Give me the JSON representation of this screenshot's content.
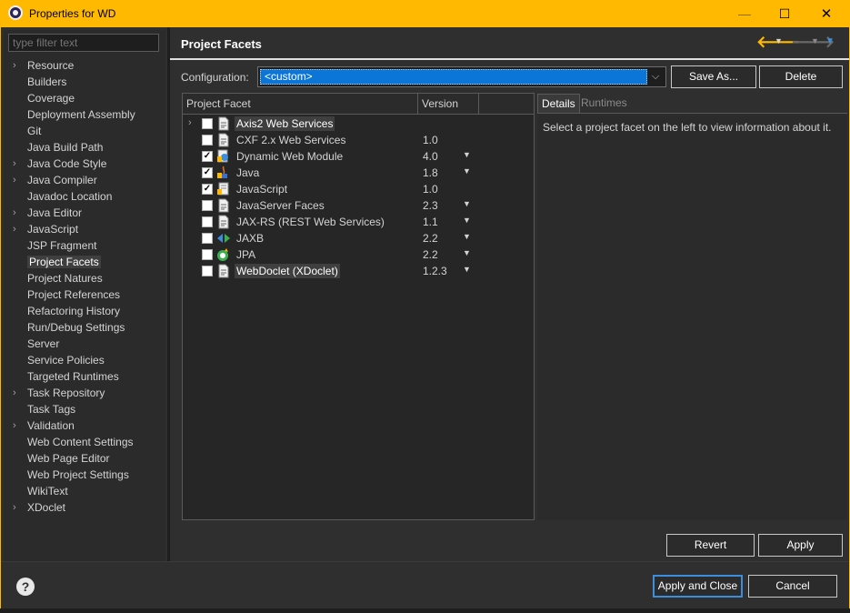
{
  "window": {
    "title": "Properties for WD",
    "minimize": "—",
    "maximize": "☐",
    "close": "✕"
  },
  "filter": {
    "placeholder": "type filter text"
  },
  "nav": {
    "items": [
      {
        "label": "Resource",
        "expandable": true
      },
      {
        "label": "Builders",
        "expandable": false
      },
      {
        "label": "Coverage",
        "expandable": false
      },
      {
        "label": "Deployment Assembly",
        "expandable": false
      },
      {
        "label": "Git",
        "expandable": false
      },
      {
        "label": "Java Build Path",
        "expandable": false
      },
      {
        "label": "Java Code Style",
        "expandable": true
      },
      {
        "label": "Java Compiler",
        "expandable": true
      },
      {
        "label": "Javadoc Location",
        "expandable": false
      },
      {
        "label": "Java Editor",
        "expandable": true
      },
      {
        "label": "JavaScript",
        "expandable": true
      },
      {
        "label": "JSP Fragment",
        "expandable": false
      },
      {
        "label": "Project Facets",
        "expandable": false,
        "selected": true
      },
      {
        "label": "Project Natures",
        "expandable": false
      },
      {
        "label": "Project References",
        "expandable": false
      },
      {
        "label": "Refactoring History",
        "expandable": false
      },
      {
        "label": "Run/Debug Settings",
        "expandable": false
      },
      {
        "label": "Server",
        "expandable": false
      },
      {
        "label": "Service Policies",
        "expandable": false
      },
      {
        "label": "Targeted Runtimes",
        "expandable": false
      },
      {
        "label": "Task Repository",
        "expandable": true
      },
      {
        "label": "Task Tags",
        "expandable": false
      },
      {
        "label": "Validation",
        "expandable": true
      },
      {
        "label": "Web Content Settings",
        "expandable": false
      },
      {
        "label": "Web Page Editor",
        "expandable": false
      },
      {
        "label": "Web Project Settings",
        "expandable": false
      },
      {
        "label": "WikiText",
        "expandable": false
      },
      {
        "label": "XDoclet",
        "expandable": true
      }
    ]
  },
  "page": {
    "title": "Project Facets"
  },
  "config": {
    "label": "Configuration:",
    "value": "<custom>",
    "save_as": "Save As...",
    "delete": "Delete"
  },
  "table": {
    "headers": {
      "facet": "Project Facet",
      "version": "Version"
    },
    "rows": [
      {
        "name": "Axis2 Web Services",
        "version": "",
        "checked": false,
        "expandable": true,
        "dropdown": false,
        "icon": "page-icon",
        "highlight": true
      },
      {
        "name": "CXF 2.x Web Services",
        "version": "1.0",
        "checked": false,
        "expandable": false,
        "dropdown": false,
        "icon": "page-icon"
      },
      {
        "name": "Dynamic Web Module",
        "version": "4.0",
        "checked": true,
        "expandable": false,
        "dropdown": true,
        "icon": "web-module-icon"
      },
      {
        "name": "Java",
        "version": "1.8",
        "checked": true,
        "expandable": false,
        "dropdown": true,
        "icon": "java-lock-icon"
      },
      {
        "name": "JavaScript",
        "version": "1.0",
        "checked": true,
        "expandable": false,
        "dropdown": false,
        "icon": "javascript-lock-icon"
      },
      {
        "name": "JavaServer Faces",
        "version": "2.3",
        "checked": false,
        "expandable": false,
        "dropdown": true,
        "icon": "page-icon"
      },
      {
        "name": "JAX-RS (REST Web Services)",
        "version": "1.1",
        "checked": false,
        "expandable": false,
        "dropdown": true,
        "icon": "page-icon"
      },
      {
        "name": "JAXB",
        "version": "2.2",
        "checked": false,
        "expandable": false,
        "dropdown": true,
        "icon": "jaxb-icon"
      },
      {
        "name": "JPA",
        "version": "2.2",
        "checked": false,
        "expandable": false,
        "dropdown": true,
        "icon": "jpa-icon"
      },
      {
        "name": "WebDoclet (XDoclet)",
        "version": "1.2.3",
        "checked": false,
        "expandable": false,
        "dropdown": true,
        "icon": "page-icon",
        "highlight": true
      }
    ]
  },
  "details": {
    "tabs": {
      "details": "Details",
      "runtimes": "Runtimes"
    },
    "text": "Select a project facet on the left to view information about it."
  },
  "buttons": {
    "revert": "Revert",
    "apply": "Apply",
    "apply_close": "Apply and Close",
    "cancel": "Cancel"
  },
  "colors": {
    "title_bar": "#ffb900",
    "selection": "#0b75d8",
    "accent": "#3c8dde"
  }
}
